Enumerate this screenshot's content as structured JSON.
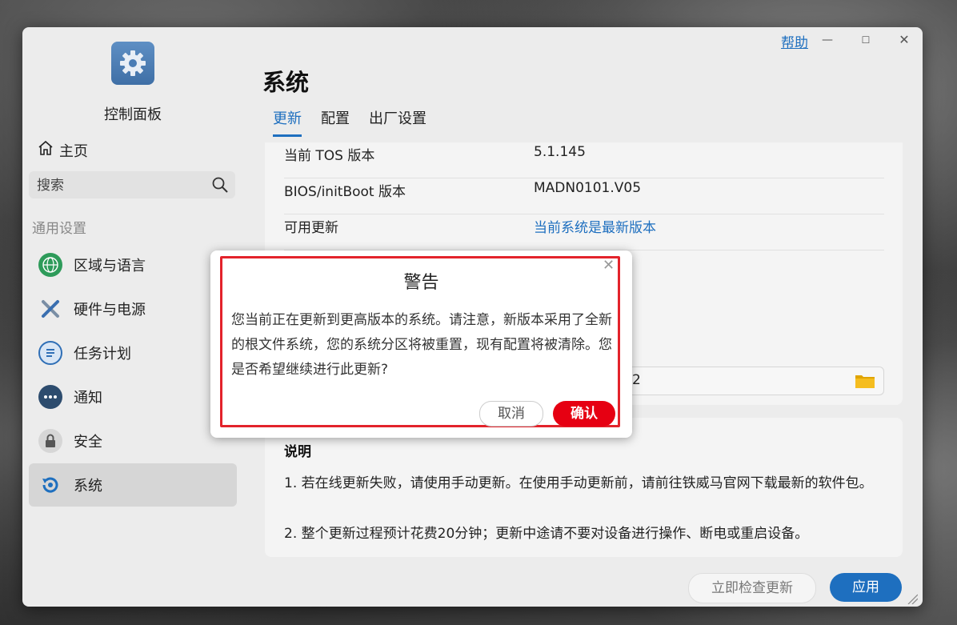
{
  "header": {
    "help": "帮助"
  },
  "sidebar": {
    "app_title": "控制面板",
    "home": "主页",
    "search_placeholder": "搜索",
    "section": "通用设置",
    "items": [
      {
        "label": "区域与语言",
        "icon": "globe-icon",
        "color": "#2e9b5a"
      },
      {
        "label": "硬件与电源",
        "icon": "tools-icon",
        "color": "#3a6fb0"
      },
      {
        "label": "任务计划",
        "icon": "task-list-icon",
        "color": "#2f6fb6"
      },
      {
        "label": "通知",
        "icon": "chat-bubble-icon",
        "color": "#2d4c6e"
      },
      {
        "label": "安全",
        "icon": "lock-icon",
        "color": "#555555"
      },
      {
        "label": "系统",
        "icon": "system-update-icon",
        "color": "#1e6fbf",
        "active": true
      }
    ]
  },
  "main": {
    "title": "系统",
    "tabs": [
      "更新",
      "配置",
      "出厂设置"
    ],
    "active_tab": "更新",
    "info": [
      {
        "label": "当前 TOS 版本",
        "value": "5.1.145"
      },
      {
        "label": "BIOS/initBoot 版本",
        "value": "MADN0101.V05"
      },
      {
        "label": "可用更新",
        "value": "当前系统是最新版本"
      }
    ],
    "file_field_value": "2",
    "notes_title": "说明",
    "notes": [
      "1. 若在线更新失败，请使用手动更新。在使用手动更新前，请前往铁威马官网下载最新的软件包。",
      "2. 整个更新过程预计花费20分钟；更新中途请不要对设备进行操作、断电或重启设备。"
    ],
    "check_update": "立即检查更新",
    "apply": "应用"
  },
  "dialog": {
    "title": "警告",
    "message": "您当前正在更新到更高版本的系统。请注意，新版本采用了全新的根文件系统，您的系统分区将被重置，现有配置将被清除。您是否希望继续进行此更新?",
    "cancel": "取消",
    "confirm": "确认",
    "highlight_color": "#e3232b",
    "confirm_color": "#e60012"
  },
  "colors": {
    "accent": "#1e6fbf"
  }
}
